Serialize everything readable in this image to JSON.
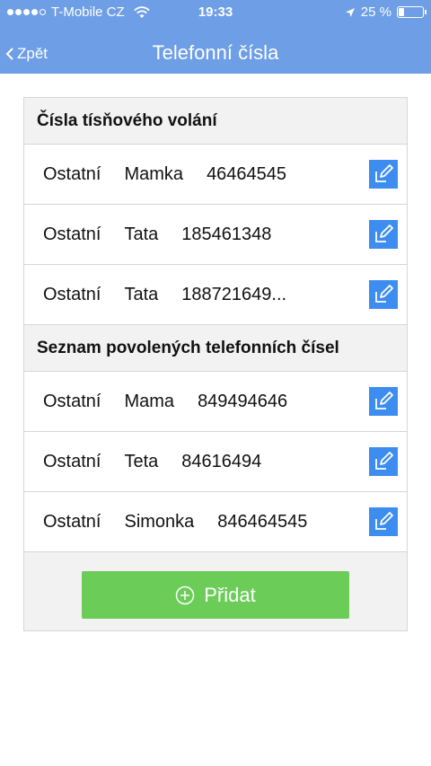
{
  "status_bar": {
    "carrier": "T-Mobile CZ",
    "time": "19:33",
    "battery_text": "25 %",
    "battery_level": 0.25,
    "signal_bars_filled": 4,
    "signal_bars_total": 5
  },
  "nav": {
    "back_label": "Zpět",
    "title": "Telefonní čísla"
  },
  "sections": [
    {
      "title": "Čísla tísňového volání",
      "rows": [
        {
          "type": "Ostatní",
          "name": "Mamka",
          "number": "46464545"
        },
        {
          "type": "Ostatní",
          "name": "Tata",
          "number": "185461348"
        },
        {
          "type": "Ostatní",
          "name": "Tata",
          "number": "188721649..."
        }
      ]
    },
    {
      "title": "Seznam povolených telefonních čísel",
      "rows": [
        {
          "type": "Ostatní",
          "name": "Mama",
          "number": "849494646"
        },
        {
          "type": "Ostatní",
          "name": "Teta",
          "number": "84616494"
        },
        {
          "type": "Ostatní",
          "name": "Simonka",
          "number": "846464545"
        }
      ]
    }
  ],
  "add_button_label": "Přidat",
  "icons": {
    "edit": "edit-pencil-icon",
    "add": "plus-circle-icon",
    "back": "chevron-left-icon",
    "wifi": "wifi-icon",
    "location": "location-arrow-icon",
    "battery": "battery-icon"
  },
  "colors": {
    "header_bg": "#6e9ee5",
    "edit_button": "#3d8cf0",
    "add_button": "#6bcd58"
  }
}
